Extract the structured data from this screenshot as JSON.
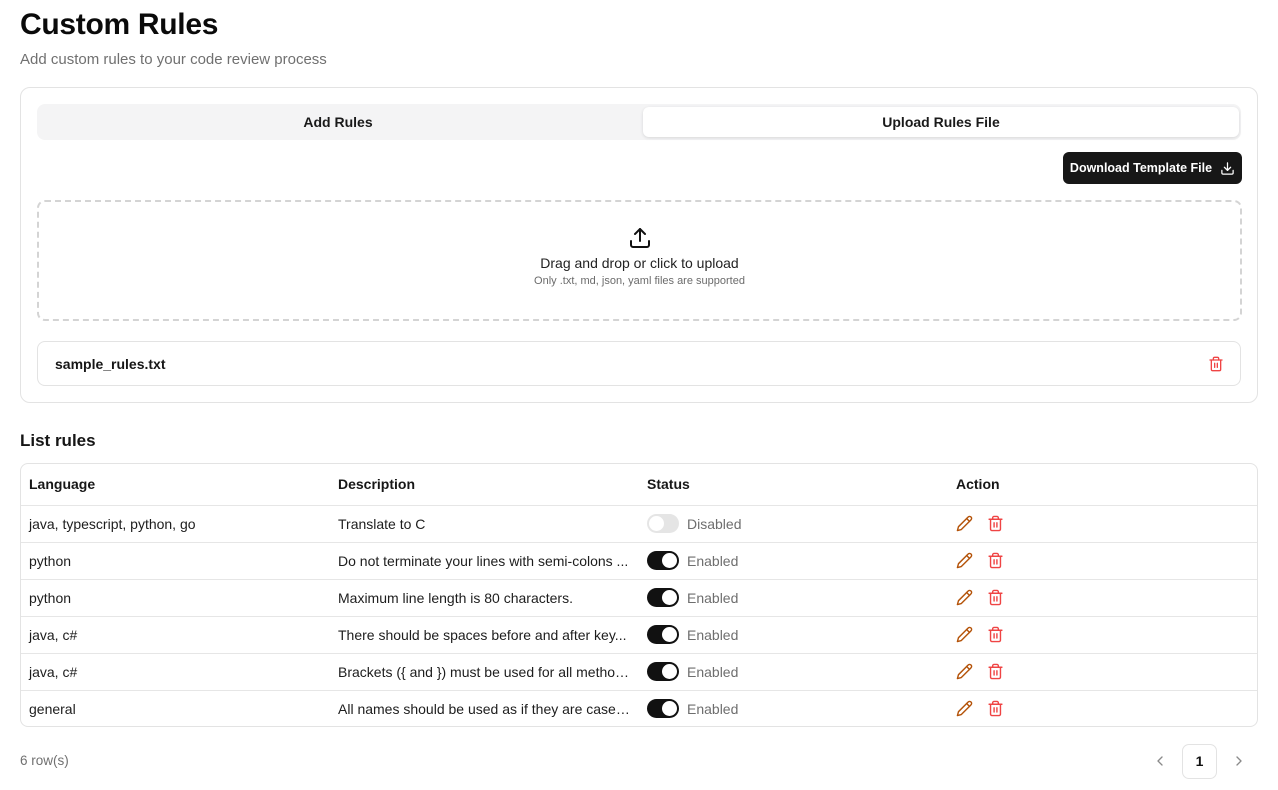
{
  "header": {
    "title": "Custom Rules",
    "subtitle": "Add custom rules to your code review process"
  },
  "tabs": [
    {
      "label": "Add Rules",
      "active": false
    },
    {
      "label": "Upload Rules File",
      "active": true
    }
  ],
  "download_button": {
    "label": "Download Template File",
    "icon": "download-icon"
  },
  "dropzone": {
    "icon": "upload-icon",
    "title": "Drag and drop or click to upload",
    "hint": "Only .txt, md, json, yaml files are supported"
  },
  "uploaded_file": {
    "name": "sample_rules.txt",
    "delete_icon": "trash-icon"
  },
  "list": {
    "title": "List rules",
    "columns": [
      "Language",
      "Description",
      "Status",
      "Action"
    ],
    "rows": [
      {
        "language": "java, typescript, python, go",
        "description": "Translate to C",
        "enabled": false,
        "status": "Disabled"
      },
      {
        "language": "python",
        "description": "Do not terminate your lines with semi-colons ...",
        "enabled": true,
        "status": "Enabled"
      },
      {
        "language": "python",
        "description": "Maximum line length is 80 characters.",
        "enabled": true,
        "status": "Enabled"
      },
      {
        "language": "java, c#",
        "description": "There should be spaces before and after key...",
        "enabled": true,
        "status": "Enabled"
      },
      {
        "language": "java, c#",
        "description": "Brackets ({ and }) must be used for all method...",
        "enabled": true,
        "status": "Enabled"
      },
      {
        "language": "general",
        "description": "All names should be used as if they are case-s...",
        "enabled": true,
        "status": "Enabled"
      }
    ]
  },
  "footer": {
    "row_count": "6 row(s)",
    "current_page": "1"
  },
  "colors": {
    "primary": "#171717",
    "edit_icon": "#b45309",
    "delete_icon": "#ef4444",
    "muted_text": "#707070",
    "border": "#e3e3e3"
  }
}
